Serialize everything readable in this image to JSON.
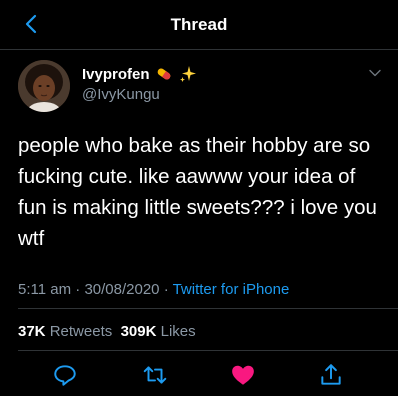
{
  "header": {
    "title": "Thread",
    "back_icon": "chevron-left-icon"
  },
  "author": {
    "name": "Ivyprofen",
    "handle": "@IvyKungu",
    "emojis": [
      "pill-emoji",
      "sparkles-emoji"
    ],
    "more_icon": "chevron-down-icon"
  },
  "tweet": {
    "text": "people who bake as their hobby are so fucking cute. like aawww your idea of fun is making little sweets??? i love you wtf",
    "time": "5:11 am",
    "date": "30/08/2020",
    "separator": "·",
    "source": "Twitter for iPhone"
  },
  "stats": {
    "retweets_count": "37K",
    "retweets_label": "Retweets",
    "likes_count": "309K",
    "likes_label": "Likes"
  },
  "actions": [
    "reply-icon",
    "retweet-icon",
    "like-icon",
    "share-icon"
  ],
  "colors": {
    "accent": "#1d9bf0",
    "like": "#f91880",
    "muted": "#8b98a5",
    "background": "#000000"
  }
}
